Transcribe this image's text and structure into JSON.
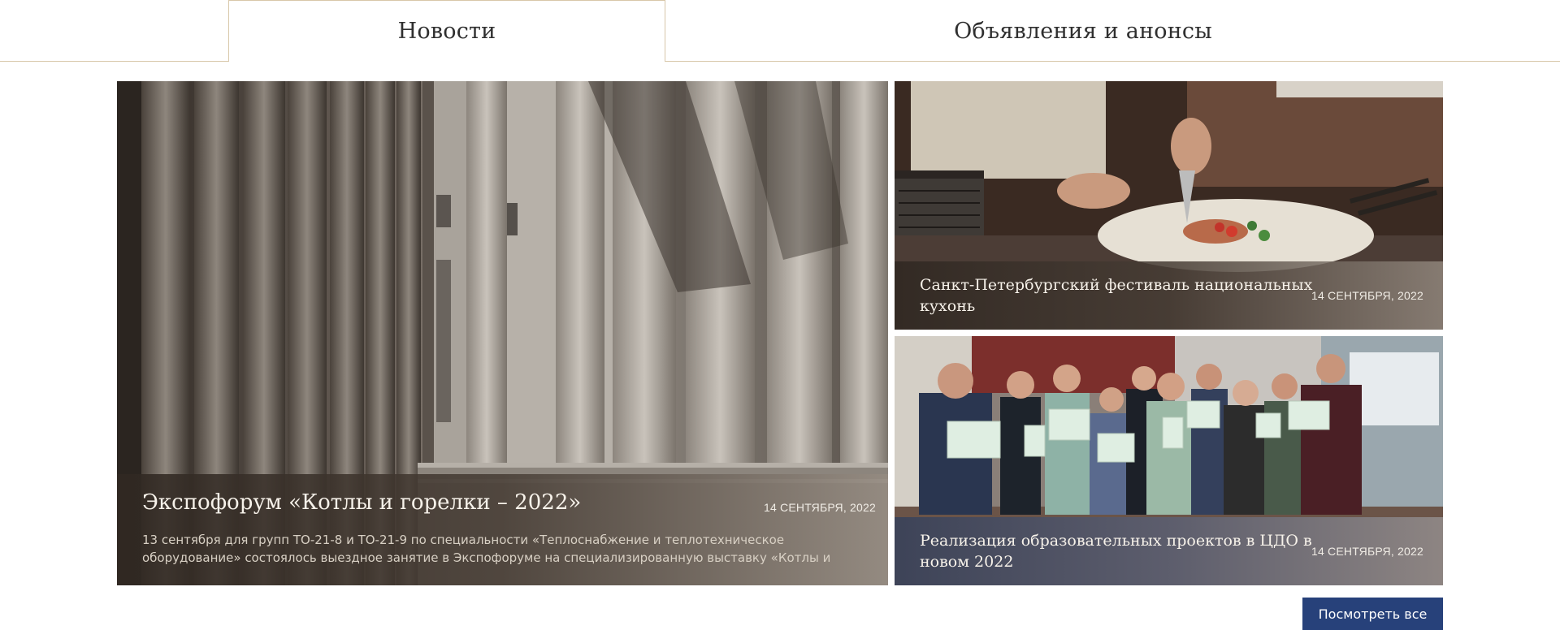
{
  "tabs": {
    "news": "Новости",
    "announcements": "Объявления и анонсы"
  },
  "cards": {
    "main": {
      "title": "Экспофорум «Котлы и горелки – 2022»",
      "date": "14 СЕНТЯБРЯ, 2022",
      "description": "13 сентября для групп ТО-21-8 и ТО-21-9 по специальности «Теплоснабжение и теплотехническое оборудование» состоялось выездное занятие в Экспофоруме на специализированную выставку «Котлы и"
    },
    "food": {
      "title": "Санкт-Петербургский фестиваль национальных кухонь",
      "date": "14 СЕНТЯБРЯ, 2022"
    },
    "group": {
      "title": "Реализация образовательных проектов в ЦДО в новом 2022",
      "date": "14 СЕНТЯБРЯ, 2022"
    }
  },
  "view_all_label": "Посмотреть все",
  "colors": {
    "accent_button": "#27417a",
    "tab_border": "#d8c7a9"
  }
}
